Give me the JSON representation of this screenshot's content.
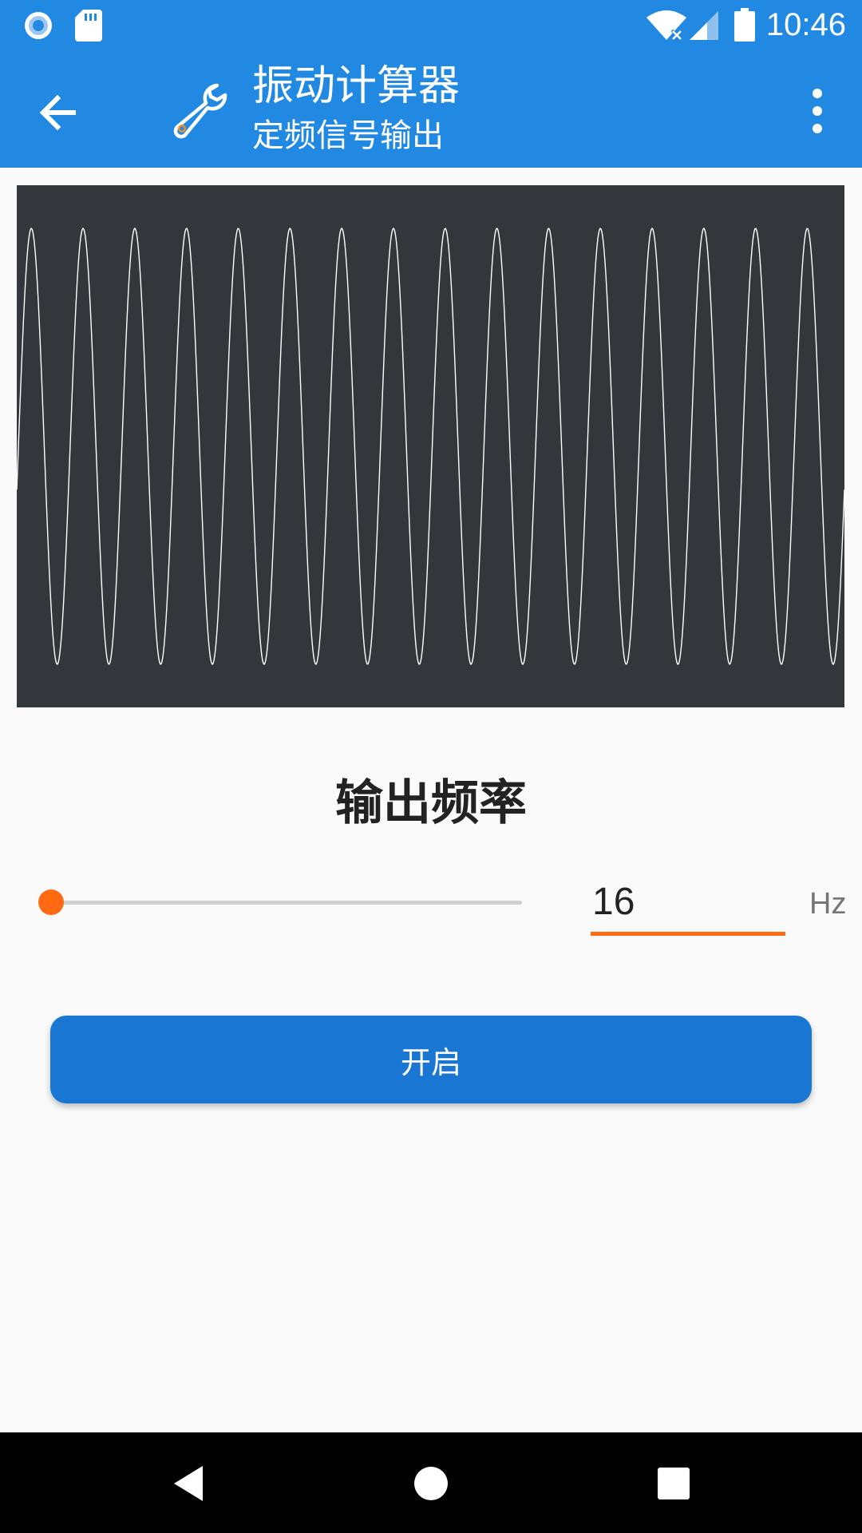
{
  "status_bar": {
    "time": "10:46",
    "icons": [
      "radio-icon",
      "sd-card-icon",
      "wifi-off-icon",
      "signal-icon",
      "battery-icon"
    ]
  },
  "app_bar": {
    "title": "振动计算器",
    "subtitle": "定频信号输出",
    "icons": [
      "back-arrow-icon",
      "wrench-icon",
      "more-vert-icon"
    ]
  },
  "waveform": {
    "background_color": "#33363B",
    "line_color": "#FFFFFF",
    "visible_cycles": 16
  },
  "frequency": {
    "section_title": "输出频率",
    "value": "16",
    "unit": "Hz",
    "slider_fraction": 0.0
  },
  "start_button": {
    "label": "开启"
  },
  "colors": {
    "primary": "#2289E3",
    "button": "#1976D2",
    "accent": "#FF6A13"
  },
  "nav_bar": {
    "icons": [
      "back-triangle-icon",
      "home-circle-icon",
      "recents-square-icon"
    ]
  }
}
